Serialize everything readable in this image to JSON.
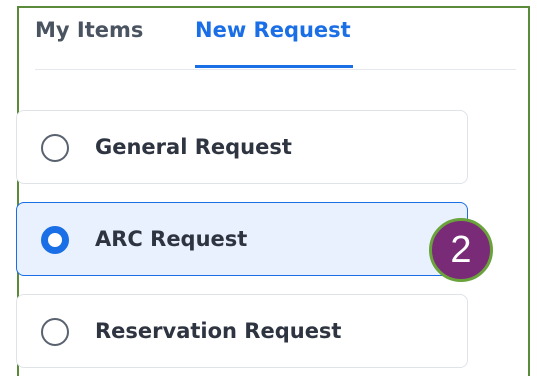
{
  "tabs": [
    {
      "label": "My Items",
      "active": false
    },
    {
      "label": "New Request",
      "active": true
    }
  ],
  "options": [
    {
      "label": "General Request",
      "selected": false
    },
    {
      "label": "ARC Request",
      "selected": true
    },
    {
      "label": "Reservation Request",
      "selected": false
    }
  ],
  "annotation": {
    "step_number": "2"
  },
  "colors": {
    "accent": "#1a6ee6",
    "selected_bg": "#e9f1fe",
    "frame_border": "#5b8a3a",
    "badge_bg": "#7a2b78",
    "badge_border": "#6aa33c"
  }
}
